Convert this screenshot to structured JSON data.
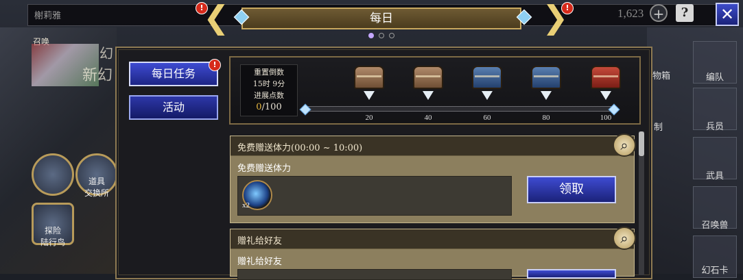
{
  "header": {
    "player_name": "榭莉雅",
    "currency_amount": "1,623",
    "title": "每日",
    "page_count": 3,
    "active_page": 1,
    "help_label": "?",
    "close_label": "✕",
    "plus_label": "+"
  },
  "left_menu": {
    "summon_label": "召唤",
    "banner_text": "新幻",
    "banner_text_top": "幻",
    "exchange_label": "道具\n交换所",
    "explore_label": "探险\n陆行鸟"
  },
  "right_menu": {
    "items": [
      "编队",
      "兵员",
      "武具",
      "召唤兽",
      "幻石卡"
    ],
    "bg_labels": [
      "物箱",
      "制"
    ]
  },
  "side_tabs": [
    {
      "label": "每日任务",
      "active": true,
      "badge": "!"
    },
    {
      "label": "活动",
      "active": false
    }
  ],
  "progress": {
    "reset_label": "重置倒数",
    "reset_time": "15时 9分",
    "points_label": "进展点数",
    "current": "0",
    "max": "/100",
    "milestones": [
      {
        "value": "20",
        "chest": "bronze"
      },
      {
        "value": "40",
        "chest": "bronze"
      },
      {
        "value": "60",
        "chest": "blue"
      },
      {
        "value": "80",
        "chest": "blue"
      },
      {
        "value": "100",
        "chest": "red"
      }
    ],
    "fill_fraction": 0.0
  },
  "missions": [
    {
      "title": "免费赠送体力(00:00 ~ 10:00)",
      "subtitle": "免费赠送体力",
      "reward_qty": "x2",
      "claim_label": "领取"
    },
    {
      "title": "赠礼给好友",
      "subtitle": "赠礼给好友",
      "claim_label": ""
    }
  ],
  "colors": {
    "accent_gold": "#c9a960",
    "button_blue": "#2d37a8",
    "badge_red": "#d62a1b",
    "progress_fill": "#e7b840"
  },
  "icons": {
    "badge": "exclamation-badge",
    "magnify": "magnifier-icon",
    "plus": "plus-icon",
    "help": "help-icon",
    "close": "close-icon"
  }
}
